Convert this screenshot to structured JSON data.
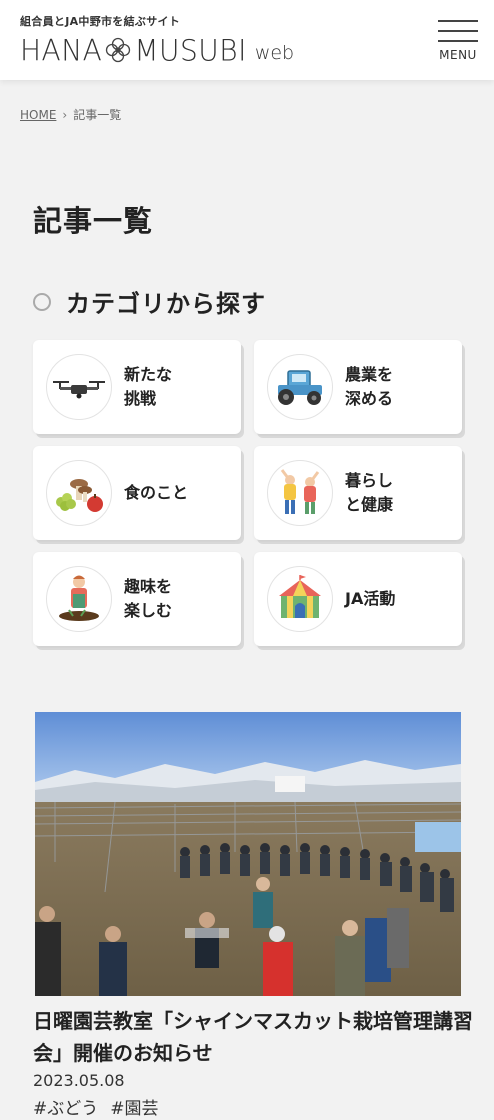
{
  "header": {
    "tagline": "組合員とJA中野市を結ぶサイト",
    "logo_left": "HANA",
    "logo_right": "MUSUBI",
    "logo_suffix": "web",
    "menu_label": "MENU"
  },
  "breadcrumb": {
    "home": "HOME",
    "separator": "›",
    "current": "記事一覧"
  },
  "page_title": "記事一覧",
  "category_section": {
    "title": "カテゴリから探す",
    "items": [
      {
        "label": "新たな\n挑戦",
        "icon": "drone-icon"
      },
      {
        "label": "農業を\n深める",
        "icon": "tractor-icon"
      },
      {
        "label": "食のこと",
        "icon": "food-icon"
      },
      {
        "label": "暮らし\nと健康",
        "icon": "exercise-icon"
      },
      {
        "label": "趣味を\n楽しむ",
        "icon": "gardening-icon"
      },
      {
        "label": "JA活動",
        "icon": "tent-icon"
      }
    ]
  },
  "article": {
    "title": "日曜園芸教室「シャインマスカット栽培管理講習会」開催のお知らせ",
    "date": "2023.05.08",
    "tags": [
      "#ぶどう",
      "#園芸"
    ],
    "image": "vineyard-workshop-photo"
  },
  "colors": {
    "background": "#f2f2f2",
    "header": "#ffffff",
    "card": "#ffffff",
    "text": "#222222"
  }
}
